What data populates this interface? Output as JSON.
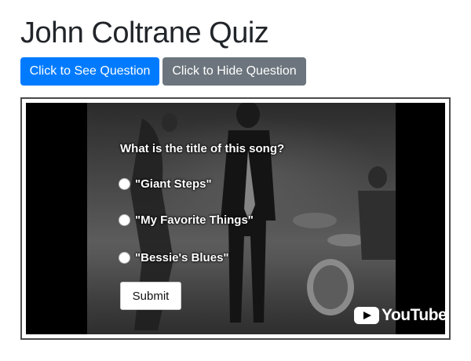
{
  "page": {
    "title": "John Coltrane Quiz"
  },
  "toolbar": {
    "show_label": "Click to See Question",
    "hide_label": "Click to Hide Question"
  },
  "quiz": {
    "question": "What is the title of this song?",
    "options": [
      "\"Giant Steps\"",
      "\"My Favorite Things\"",
      "\"Bessie's Blues\""
    ],
    "submit_label": "Submit"
  },
  "video": {
    "brand": "YouTube"
  },
  "colors": {
    "primary": "#007bff",
    "secondary": "#6c757d",
    "title_text": "#212529"
  }
}
